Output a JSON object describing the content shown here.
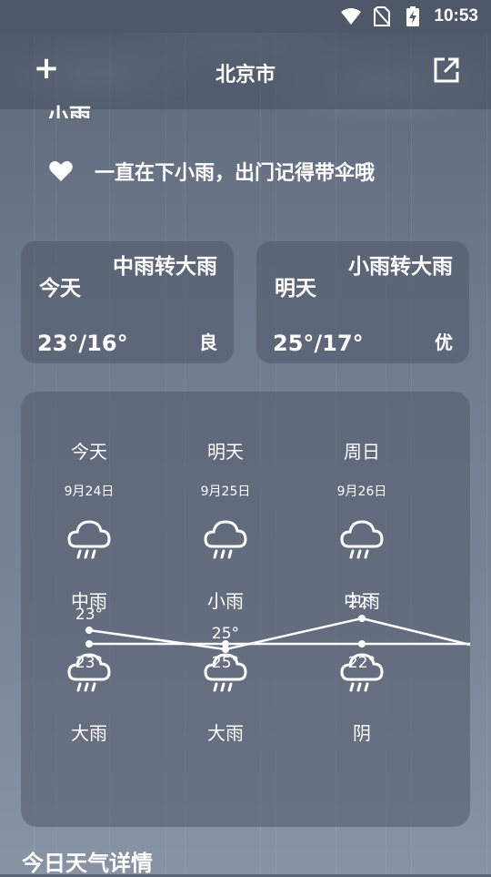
{
  "status_bar": {
    "time": "10:53",
    "icons": [
      "wifi-icon",
      "no-sim-icon",
      "battery-charging-icon"
    ]
  },
  "toolbar": {
    "title": "北京市",
    "add_icon": "plus-icon",
    "share_icon": "share-icon"
  },
  "current": {
    "condition": "小雨",
    "tip_icon": "heart-icon",
    "tip": "一直在下小雨，出门记得带伞哦"
  },
  "day_cards": [
    {
      "label": "今天",
      "condition": "中雨转大雨",
      "temp": "23°/16°",
      "aqi": "良"
    },
    {
      "label": "明天",
      "condition": "小雨转大雨",
      "temp": "25°/17°",
      "aqi": "优"
    }
  ],
  "forecast": {
    "days": [
      {
        "day": "今天",
        "date": "9月24日",
        "day_condition": "中雨",
        "day_icon": "rain-cloud-icon",
        "night_condition": "大雨",
        "night_icon": "rain-cloud-icon",
        "high": "23°",
        "low": "23°"
      },
      {
        "day": "明天",
        "date": "9月25日",
        "day_condition": "小雨",
        "day_icon": "rain-cloud-icon",
        "night_condition": "大雨",
        "night_icon": "rain-cloud-icon",
        "high": "25°",
        "low": "25°"
      },
      {
        "day": "周日",
        "date": "9月26日",
        "day_condition": "中雨",
        "day_icon": "rain-cloud-icon",
        "night_condition": "阴",
        "night_icon": "rain-cloud-icon",
        "high": "22°",
        "low": "22°"
      }
    ]
  },
  "chart_data": {
    "type": "line",
    "categories": [
      "今天",
      "明天",
      "周日",
      ""
    ],
    "series": [
      {
        "values": [
          23,
          25,
          22,
          null
        ]
      },
      {
        "values": [
          23,
          25,
          22,
          null
        ]
      }
    ]
  },
  "details": {
    "title": "今日天气详情"
  }
}
